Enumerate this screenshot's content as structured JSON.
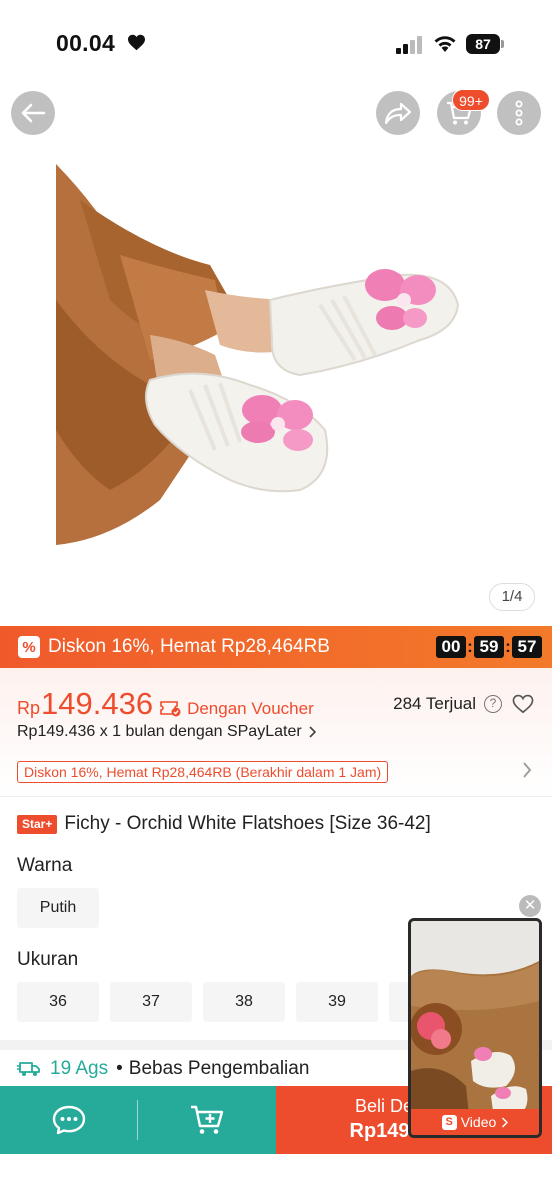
{
  "status_bar": {
    "time": "00.04",
    "battery": "87"
  },
  "product_image": {
    "counter": "1/4",
    "cart_badge": "99+"
  },
  "flash_sale": {
    "text": "Diskon 16%, Hemat Rp28,464RB",
    "icon_glyph": "%",
    "countdown": {
      "hours": "00",
      "minutes": "59",
      "seconds": "57"
    }
  },
  "price": {
    "currency": "Rp",
    "value": "149.436",
    "voucher_text": "Dengan Voucher",
    "sold": "284 Terjual",
    "spaylater": "Rp149.436 x 1 bulan dengan SPayLater",
    "promo": "Diskon 16%, Hemat Rp28,464RB (Berakhir dalam 1 Jam)"
  },
  "product": {
    "badge": "Star+",
    "title": "Fichy - Orchid White Flatshoes [Size 36-42]"
  },
  "variants": {
    "color_label": "Warna",
    "colors": [
      "Putih"
    ],
    "size_label": "Ukuran",
    "sizes": [
      "36",
      "37",
      "38",
      "39"
    ]
  },
  "shipping": {
    "date": "19 Ags",
    "returns": "Bebas Pengembalian"
  },
  "bottom_bar": {
    "buy_label": "Beli Denga",
    "buy_price": "Rp149.436"
  },
  "video": {
    "label": "Video"
  },
  "colors": {
    "primary": "#ee4d2d",
    "teal": "#26aa99"
  }
}
